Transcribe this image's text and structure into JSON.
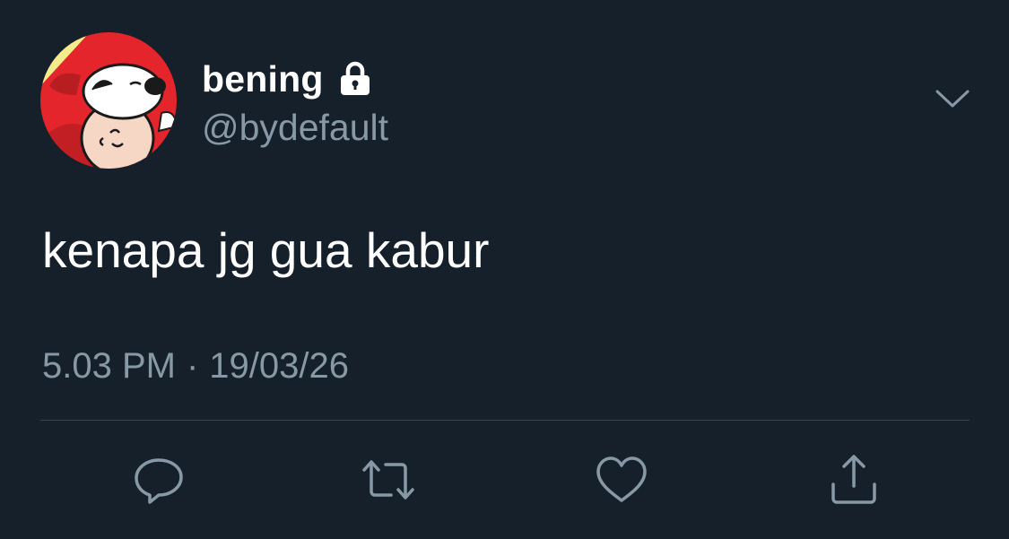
{
  "tweet": {
    "author": {
      "display_name": "bening",
      "handle": "@bydefault",
      "protected": true,
      "avatar": "snoopy-charlie-brown-avatar"
    },
    "text": "kenapa jg gua kabur",
    "time": "5.03 PM",
    "separator": "·",
    "date": "19/03/26",
    "actions": [
      "reply-icon",
      "retweet-icon",
      "like-icon",
      "share-icon"
    ]
  },
  "colors": {
    "background": "#15202b",
    "primary_text": "#ffffff",
    "secondary_text": "#8899a6",
    "divider": "#38444d"
  }
}
